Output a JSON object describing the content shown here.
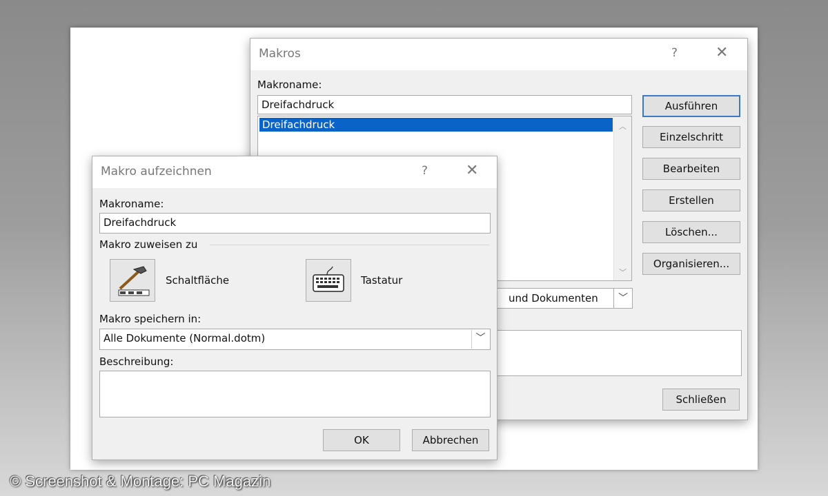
{
  "watermark": "© Screenshot & Montage: PC Magazin",
  "makros_dialog": {
    "title": "Makros",
    "help": "?",
    "close": "✕",
    "name_label": "Makroname:",
    "name_value": "Dreifachdruck",
    "list_items": [
      "Dreifachdruck"
    ],
    "buttons": {
      "run": "Ausführen",
      "step": "Einzelschritt",
      "edit": "Bearbeiten",
      "create": "Erstellen",
      "delete": "Löschen...",
      "organize": "Organisieren..."
    },
    "location_value": "und Dokumenten",
    "close_button": "Schließen"
  },
  "record_dialog": {
    "title": "Makro aufzeichnen",
    "help": "?",
    "close": "✕",
    "name_label": "Makroname:",
    "name_value": "Dreifachdruck",
    "assign_label": "Makro zuweisen zu",
    "button_option": "Schaltfläche",
    "keyboard_option": "Tastatur",
    "store_label": "Makro speichern in:",
    "store_value": "Alle Dokumente (Normal.dotm)",
    "description_label": "Beschreibung:",
    "description_value": "",
    "ok": "OK",
    "cancel": "Abbrechen"
  }
}
